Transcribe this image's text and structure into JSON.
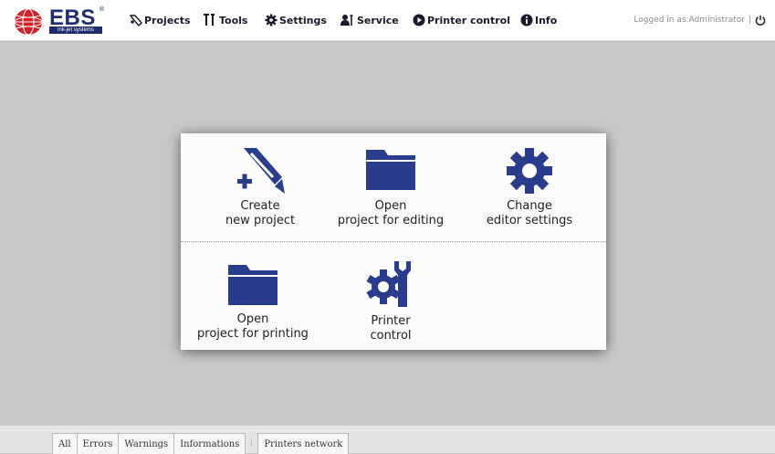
{
  "brand": {
    "name": "EBS",
    "reg": "®",
    "subtitle": "ink-jet systems"
  },
  "nav": {
    "items": [
      {
        "label": "Projects",
        "icon": "projects-icon"
      },
      {
        "label": "Tools",
        "icon": "tools-icon"
      },
      {
        "label": "Settings",
        "icon": "settings-icon"
      },
      {
        "label": "Service",
        "icon": "service-icon"
      },
      {
        "label": "Printer control",
        "icon": "printer-control-icon"
      },
      {
        "label": "Info",
        "icon": "info-icon"
      }
    ],
    "logged_in": "Logged in as:Administrator",
    "separator": "|",
    "logout_icon": "power-icon"
  },
  "tiles": [
    {
      "line1": "Create",
      "line2": "new project",
      "icon": "create-project-icon"
    },
    {
      "line1": "Open",
      "line2": "project for editing",
      "icon": "folder-icon"
    },
    {
      "line1": "Change",
      "line2": "editor settings",
      "icon": "gear-icon"
    },
    {
      "line1": "Open",
      "line2": "project for printing",
      "icon": "folder-icon"
    },
    {
      "line1": "Printer",
      "line2": "control",
      "icon": "gear-wrench-icon"
    }
  ],
  "bottom_tabs": {
    "filters": [
      "All",
      "Errors",
      "Warnings",
      "Informations"
    ],
    "network": "Printers network",
    "separator": "⁞"
  },
  "colors": {
    "icon_blue": "#2a3c8c",
    "background": "#c9cacc",
    "brand_red": "#d81e2a"
  }
}
